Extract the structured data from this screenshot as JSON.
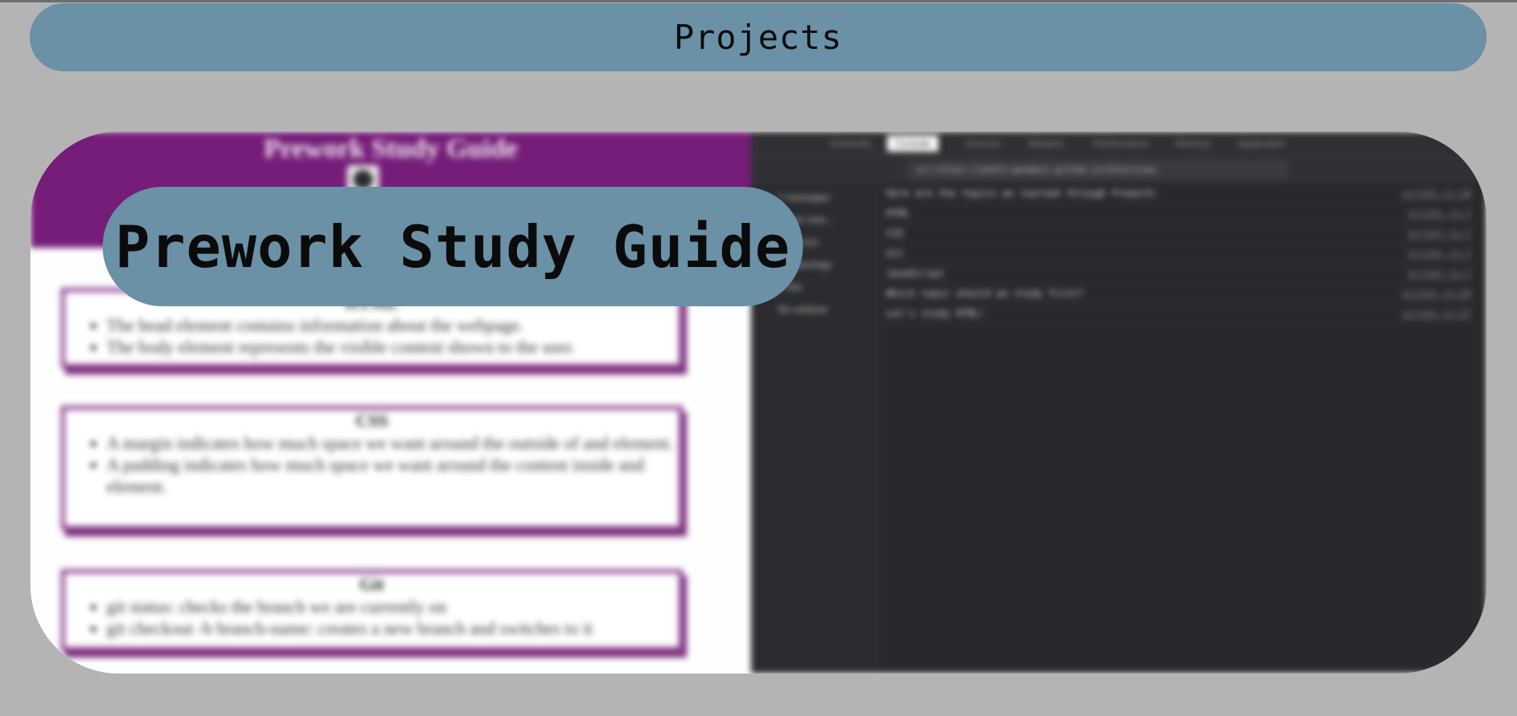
{
  "header": {
    "title": "Projects"
  },
  "overlay": {
    "title": "Prework Study Guide"
  },
  "screenshot": {
    "page": {
      "heading": "Prework Study Guide",
      "topics": [
        {
          "title": "HTML",
          "items": [
            "The head element contains information about the webpage.",
            "The body element represents the visible content shown to the user."
          ]
        },
        {
          "title": "CSS",
          "items": [
            "A margin indicates how much space we want around the outside of and element.",
            "A padding indicates how much space we want around the content inside and element."
          ]
        },
        {
          "title": "Git",
          "items": [
            "git status: checks the branch we are currently on",
            "git checkout -b branch-name: creates a new branch and switches to it"
          ]
        }
      ]
    },
    "devtools": {
      "tabs": [
        "Elements",
        "Console",
        "Sources",
        "Network",
        "Performance",
        "Memory",
        "Application"
      ],
      "filter_url": "url:https://andre-goodwin.github.io/Interview",
      "sidebar": [
        "7 messages",
        "7 user mes...",
        "No errors",
        "No warnings",
        "7 info",
        "No verbose"
      ],
      "console": [
        {
          "msg": "Here are the topics we learned through Prework:",
          "src": "script.js:10"
        },
        {
          "msg": "HTML",
          "src": "script.js:7"
        },
        {
          "msg": "CSS",
          "src": "script.js:7"
        },
        {
          "msg": "Git",
          "src": "script.js:7"
        },
        {
          "msg": "JavaScript",
          "src": "script.js:7"
        },
        {
          "msg": "Which topic should we study first?",
          "src": "script.js:16"
        },
        {
          "msg": "Let's study HTML!",
          "src": "script.js:17"
        }
      ]
    }
  },
  "colors": {
    "pill": "#6b91a6",
    "page_background": "#b4b4b4",
    "guide_header": "#751d78",
    "devtools_background": "#28292c"
  }
}
